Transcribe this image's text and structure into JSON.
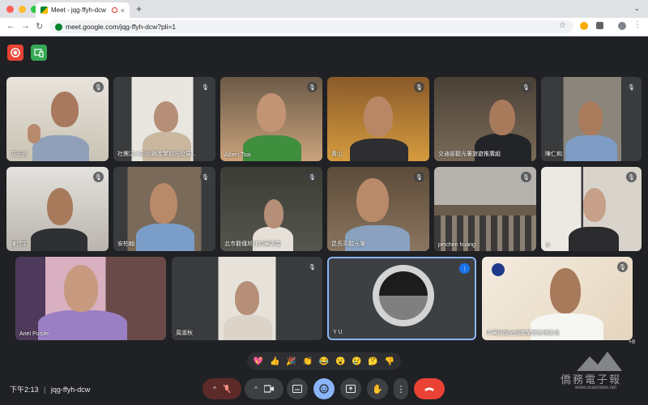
{
  "browser": {
    "tab_title": "Meet - jqg-ffyh-dcw",
    "tab_close": "×",
    "new_tab": "+",
    "url": "meet.google.com/jqg-ffyh-dcw?pli=1"
  },
  "participants": [
    {
      "name": "方正光"
    },
    {
      "name": "社團法人彰化縣產業觀光發展..."
    },
    {
      "name": "Albert Tsai"
    },
    {
      "name": "黃山"
    },
    {
      "name": "交通部觀光署旅遊推廣組"
    },
    {
      "name": "陳仁和"
    },
    {
      "name": "陳信宇"
    },
    {
      "name": "安柏翰"
    },
    {
      "name": "北市觀傳旭江春華專委"
    },
    {
      "name": "昆長高觀光署"
    },
    {
      "name": "peichen huang"
    },
    {
      "name": "pc"
    },
    {
      "name": "Ariel Purple"
    },
    {
      "name": "周淑秋"
    },
    {
      "name": "Y U"
    },
    {
      "name": "中華民國全國商業總會理事長"
    }
  ],
  "more_count": "+8",
  "reactions": [
    "💖",
    "👍",
    "🎉",
    "👏",
    "😂",
    "😮",
    "😢",
    "🤔",
    "👎"
  ],
  "bottom": {
    "time": "下午2:13",
    "separator": "|",
    "meeting_code": "jqg-ffyh-dcw"
  },
  "watermark": {
    "line1": "僑務電子報",
    "line2": "www.ocacnews.net"
  },
  "colors": {
    "accent": "#8ab4f8",
    "end_call": "#ea4335",
    "record": "#ea4335"
  }
}
